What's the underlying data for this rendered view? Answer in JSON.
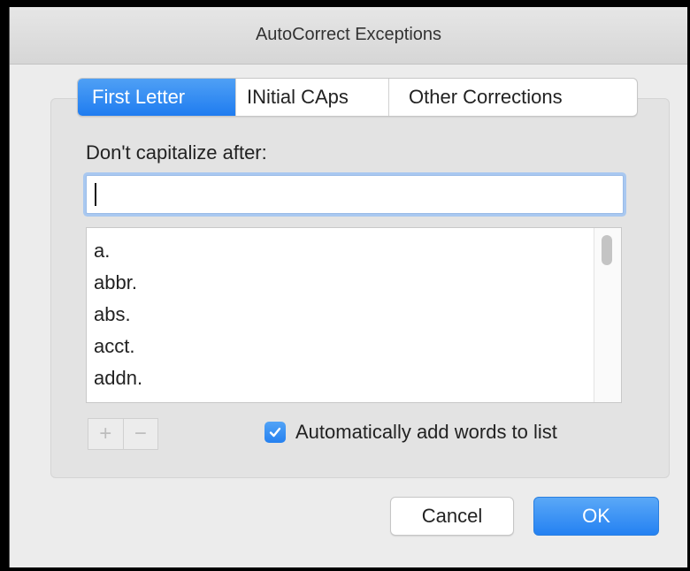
{
  "window": {
    "title": "AutoCorrect Exceptions"
  },
  "tabs": [
    {
      "label": "First Letter",
      "active": true
    },
    {
      "label": "INitial CAps",
      "active": false
    },
    {
      "label": "Other Corrections",
      "active": false
    }
  ],
  "first_letter": {
    "field_label": "Don't capitalize after:",
    "input_value": "",
    "list_items": [
      "a.",
      "abbr.",
      "abs.",
      "acct.",
      "addn."
    ],
    "add_button": "+",
    "remove_button": "−",
    "auto_add": {
      "label": "Automatically add words to list",
      "checked": true
    }
  },
  "buttons": {
    "cancel": "Cancel",
    "ok": "OK"
  },
  "colors": {
    "accent": "#2581f0",
    "focus_ring": "#a9c8f0"
  }
}
